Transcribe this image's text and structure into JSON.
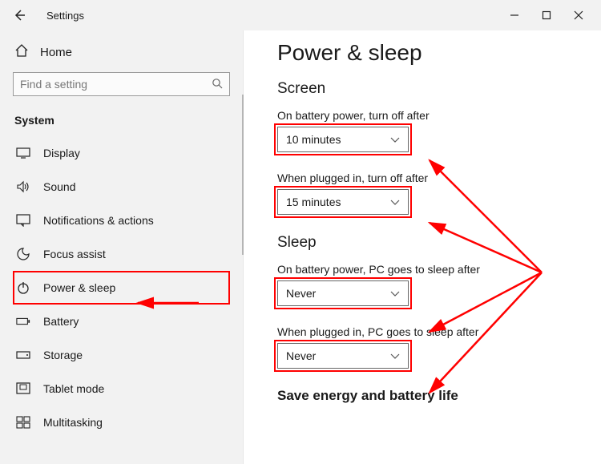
{
  "window": {
    "title": "Settings"
  },
  "sidebar": {
    "home": "Home",
    "search_placeholder": "Find a setting",
    "section": "System",
    "items": [
      {
        "label": "Display"
      },
      {
        "label": "Sound"
      },
      {
        "label": "Notifications & actions"
      },
      {
        "label": "Focus assist"
      },
      {
        "label": "Power & sleep"
      },
      {
        "label": "Battery"
      },
      {
        "label": "Storage"
      },
      {
        "label": "Tablet mode"
      },
      {
        "label": "Multitasking"
      }
    ]
  },
  "content": {
    "page_title": "Power & sleep",
    "screen": {
      "heading": "Screen",
      "battery_label": "On battery power, turn off after",
      "battery_value": "10 minutes",
      "plugged_label": "When plugged in, turn off after",
      "plugged_value": "15 minutes"
    },
    "sleep": {
      "heading": "Sleep",
      "battery_label": "On battery power, PC goes to sleep after",
      "battery_value": "Never",
      "plugged_label": "When plugged in, PC goes to sleep after",
      "plugged_value": "Never"
    },
    "save_heading": "Save energy and battery life"
  },
  "annotation_color": "#ff0000"
}
